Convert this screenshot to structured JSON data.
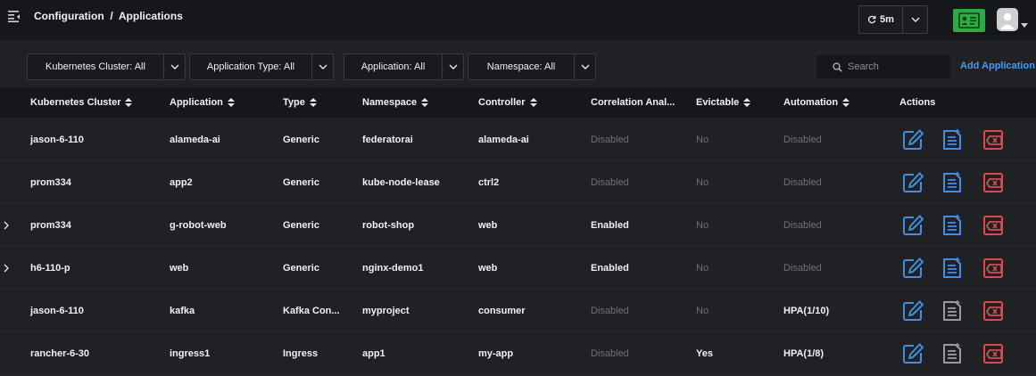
{
  "header": {
    "breadcrumb": "Configuration  /  Applications",
    "refresh_interval": "5m"
  },
  "filters": [
    {
      "label": "Kubernetes Cluster: All"
    },
    {
      "label": "Application Type: All"
    },
    {
      "label": "Application: All"
    },
    {
      "label": "Namespace: All"
    }
  ],
  "search": {
    "placeholder": "Search"
  },
  "add_application_label": "Add Application",
  "table": {
    "columns": [
      {
        "label": "Kubernetes Cluster",
        "sortable": true
      },
      {
        "label": "Application",
        "sortable": true
      },
      {
        "label": "Type",
        "sortable": true
      },
      {
        "label": "Namespace",
        "sortable": true
      },
      {
        "label": "Controller",
        "sortable": true
      },
      {
        "label": "Correlation Anal...",
        "sortable": false
      },
      {
        "label": "Evictable",
        "sortable": true
      },
      {
        "label": "Automation",
        "sortable": true
      },
      {
        "label": "Actions",
        "sortable": false
      }
    ],
    "rows": [
      {
        "expandable": false,
        "cluster": "jason-6-110",
        "application": "alameda-ai",
        "type": "Generic",
        "namespace": "federatorai",
        "controller": "alameda-ai",
        "correlation": "Disabled",
        "evictable": "No",
        "automation": "Disabled",
        "detail_enabled": true
      },
      {
        "expandable": false,
        "cluster": "prom334",
        "application": "app2",
        "type": "Generic",
        "namespace": "kube-node-lease",
        "controller": "ctrl2",
        "correlation": "Disabled",
        "evictable": "No",
        "automation": "Disabled",
        "detail_enabled": true
      },
      {
        "expandable": true,
        "cluster": "prom334",
        "application": "g-robot-web",
        "type": "Generic",
        "namespace": "robot-shop",
        "controller": "web",
        "correlation": "Enabled",
        "evictable": "No",
        "automation": "Disabled",
        "detail_enabled": true
      },
      {
        "expandable": true,
        "cluster": "h6-110-p",
        "application": "web",
        "type": "Generic",
        "namespace": "nginx-demo1",
        "controller": "web",
        "correlation": "Enabled",
        "evictable": "No",
        "automation": "Disabled",
        "detail_enabled": true
      },
      {
        "expandable": false,
        "cluster": "jason-6-110",
        "application": "kafka",
        "type": "Kafka Con...",
        "namespace": "myproject",
        "controller": "consumer",
        "correlation": "Disabled",
        "evictable": "No",
        "automation": "HPA(1/10)",
        "detail_enabled": false
      },
      {
        "expandable": false,
        "cluster": "rancher-6-30",
        "application": "ingress1",
        "type": "Ingress",
        "namespace": "app1",
        "controller": "my-app",
        "correlation": "Disabled",
        "evictable": "Yes",
        "automation": "HPA(1/8)",
        "detail_enabled": false
      }
    ]
  },
  "colors": {
    "accent_blue": "#3d8fe6",
    "delete_red": "#e0474c",
    "detail_gray": "#9a9ba0",
    "id_card_green": "#2eaa45"
  },
  "icons": {
    "menu": "menu-collapse-icon",
    "refresh": "refresh-icon",
    "caret": "chevron-down-icon",
    "id_card": "id-card-icon",
    "avatar": "user-avatar-icon",
    "search": "search-icon",
    "sort": "sort-icon",
    "expand": "chevron-right-icon",
    "edit": "edit-icon",
    "detail": "document-add-icon",
    "delete": "delete-icon"
  }
}
